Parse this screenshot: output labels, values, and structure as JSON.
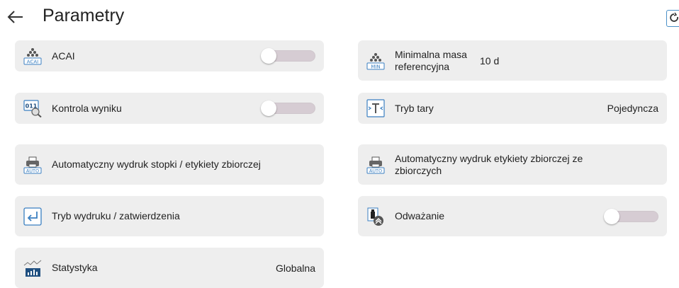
{
  "header": {
    "title": "Parametry"
  },
  "left": [
    {
      "label": "ACAI",
      "icon": "acai-icon",
      "control": "toggle",
      "toggle_on": false,
      "icon_text": "ACAI"
    },
    {
      "label": "Kontrola wyniku",
      "icon": "result-check-icon",
      "control": "toggle",
      "toggle_on": false,
      "icon_text": "011"
    },
    {
      "label": "Automatyczny wydruk stopki / etykiety zbiorczej",
      "icon": "auto-print-icon",
      "control": "none",
      "icon_text": "AUTO"
    },
    {
      "label": "Tryb wydruku / zatwierdzenia",
      "icon": "enter-icon",
      "control": "none"
    },
    {
      "label": "Statystyka",
      "icon": "statistics-icon",
      "control": "value",
      "value": "Globalna"
    }
  ],
  "right": [
    {
      "label": "Minimalna masa referencyjna",
      "icon": "min-mass-icon",
      "control": "value",
      "value": "10 d",
      "icon_text": "MIN"
    },
    {
      "label": "Tryb tary",
      "icon": "tare-icon",
      "control": "value",
      "value": "Pojedyncza"
    },
    {
      "label": "Automatyczny wydruk etykiety zbiorczej ze zbiorczych",
      "icon": "auto-print-icon",
      "control": "none",
      "icon_text": "AUTO"
    },
    {
      "label": "Odważanie",
      "icon": "dosing-icon",
      "control": "toggle",
      "toggle_on": false
    }
  ]
}
